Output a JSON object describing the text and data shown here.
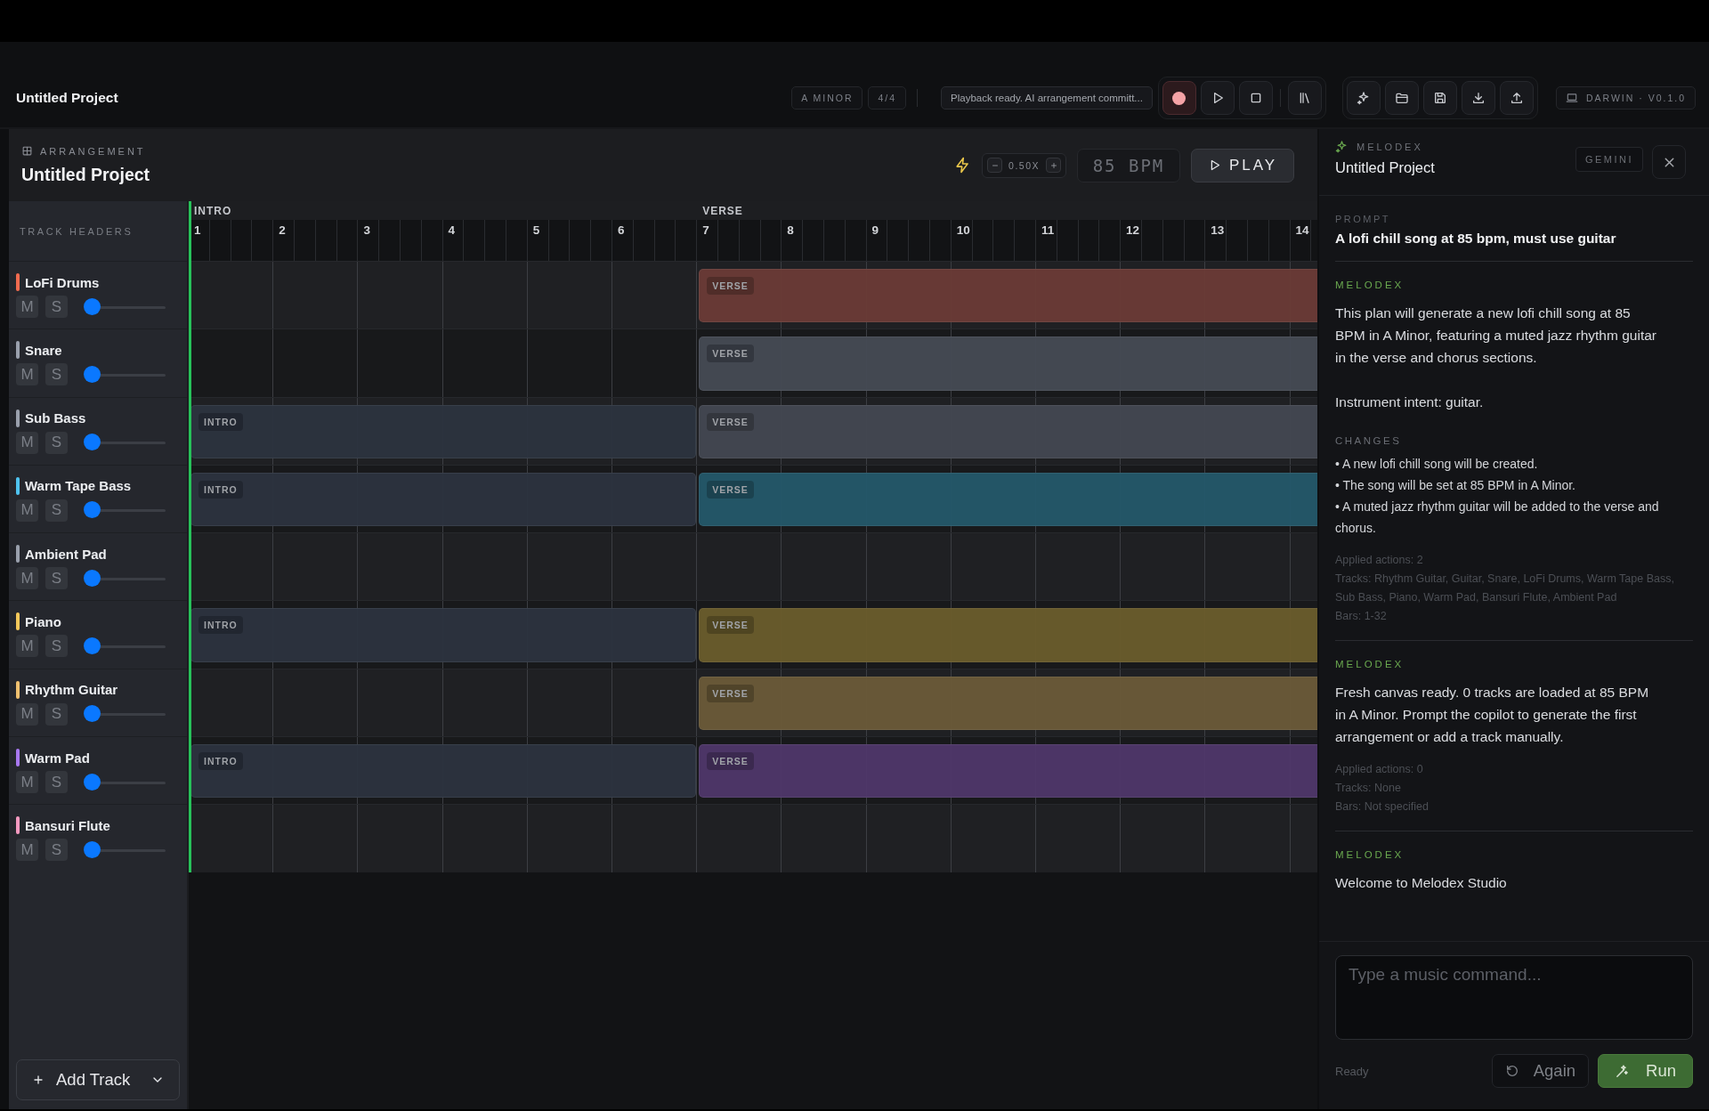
{
  "topbar": {
    "title": "Untitled Project",
    "key": "A MINOR",
    "meter": "4/4",
    "status": "Playback ready. AI arrangement committ...",
    "version": "DARWIN · V0.1.0"
  },
  "arrangement": {
    "label": "ARRANGEMENT",
    "title": "Untitled Project",
    "zoom": "0.50X",
    "tempo": "85 BPM",
    "play": "PLAY",
    "headers_label": "TRACK HEADERS",
    "sections": [
      {
        "kind": "intro",
        "label": "INTRO"
      },
      {
        "kind": "verse",
        "label": "VERSE"
      }
    ],
    "bars": [
      "1",
      "2",
      "3",
      "4",
      "5",
      "6",
      "7",
      "8",
      "9",
      "10",
      "11",
      "12",
      "13",
      "14"
    ],
    "tracks": [
      {
        "name": "LoFi Drums",
        "color": "#f26b4f",
        "mute_label": "M",
        "solo_label": "S",
        "muted": false,
        "soloed": false,
        "level": 0,
        "clips": [
          {
            "kind": "verse",
            "label": "VERSE",
            "color": "#6a3b36"
          }
        ]
      },
      {
        "name": "Snare",
        "color": "#9aa0ad",
        "mute_label": "M",
        "solo_label": "S",
        "muted": false,
        "soloed": false,
        "level": 0,
        "clips": [
          {
            "kind": "verse",
            "label": "VERSE",
            "color": "#454a54"
          }
        ]
      },
      {
        "name": "Sub Bass",
        "color": "#9aa0ad",
        "mute_label": "M",
        "solo_label": "S",
        "muted": false,
        "soloed": false,
        "level": 0,
        "clips": [
          {
            "kind": "intro",
            "label": "INTRO",
            "color": "#2c333f"
          },
          {
            "kind": "verse",
            "label": "VERSE",
            "color": "#434751"
          }
        ]
      },
      {
        "name": "Warm Tape Bass",
        "color": "#4fc3f0",
        "mute_label": "M",
        "solo_label": "S",
        "muted": false,
        "soloed": false,
        "level": 0,
        "clips": [
          {
            "kind": "intro",
            "label": "INTRO",
            "color": "#2c333f"
          },
          {
            "kind": "verse",
            "label": "VERSE",
            "color": "#24586a"
          }
        ]
      },
      {
        "name": "Ambient Pad",
        "color": "#9aa0ad",
        "mute_label": "M",
        "solo_label": "S",
        "muted": false,
        "soloed": false,
        "level": 0
      },
      {
        "name": "Piano",
        "color": "#f5c85a",
        "mute_label": "M",
        "solo_label": "S",
        "muted": false,
        "soloed": false,
        "level": 0,
        "clips": [
          {
            "kind": "intro",
            "label": "INTRO",
            "color": "#2c333f"
          },
          {
            "kind": "verse",
            "label": "VERSE",
            "color": "#6a5c2c"
          }
        ]
      },
      {
        "name": "Rhythm Guitar",
        "color": "#f0c070",
        "mute_label": "M",
        "solo_label": "S",
        "muted": false,
        "soloed": false,
        "level": 0,
        "clips": [
          {
            "kind": "verse",
            "label": "VERSE",
            "color": "#6a5a38"
          }
        ]
      },
      {
        "name": "Warm Pad",
        "color": "#a878f0",
        "mute_label": "M",
        "solo_label": "S",
        "muted": false,
        "soloed": false,
        "level": 0,
        "clips": [
          {
            "kind": "intro",
            "label": "INTRO",
            "color": "#2c333f"
          },
          {
            "kind": "verse",
            "label": "VERSE",
            "color": "#4f376a"
          }
        ]
      },
      {
        "name": "Bansuri Flute",
        "color": "#f59ac0",
        "mute_label": "M",
        "solo_label": "S",
        "muted": false,
        "soloed": false,
        "level": 0
      }
    ],
    "add_track": "Add Track"
  },
  "copilot": {
    "brand": "MELODEX",
    "title": "Untitled Project",
    "model": "GEMINI",
    "prompt_label": "PROMPT",
    "prompt": "A lofi chill song at 85 bpm, must use guitar",
    "messages": [
      {
        "author": "MELODEX",
        "paragraphs": [
          "This plan will generate a new lofi chill song at 85 BPM in A Minor, featuring a muted jazz rhythm guitar in the verse and chorus sections.",
          "Instrument intent: guitar."
        ],
        "changes_label": "CHANGES",
        "changes": [
          "• A new lofi chill song will be created.",
          "• The song will be set at 85 BPM in A Minor.",
          "• A muted jazz rhythm guitar will be added to the verse and chorus."
        ],
        "meta": [
          "Applied actions: 2",
          "Tracks: Rhythm Guitar, Guitar, Snare, LoFi Drums, Warm Tape Bass, Sub Bass, Piano, Warm Pad, Bansuri Flute, Ambient Pad",
          "Bars: 1-32"
        ]
      },
      {
        "author": "MELODEX",
        "paragraphs": [
          "Fresh canvas ready. 0 tracks are loaded at 85 BPM in A Minor. Prompt the copilot to generate the first arrangement or add a track manually."
        ],
        "meta": [
          "Applied actions: 0",
          "Tracks: None",
          "Bars: Not specified"
        ]
      },
      {
        "author": "MELODEX",
        "paragraphs": [
          "Welcome to Melodex Studio"
        ]
      }
    ],
    "placeholder": "Type a music command...",
    "status": "Ready",
    "again": "Again",
    "run": "Run"
  }
}
